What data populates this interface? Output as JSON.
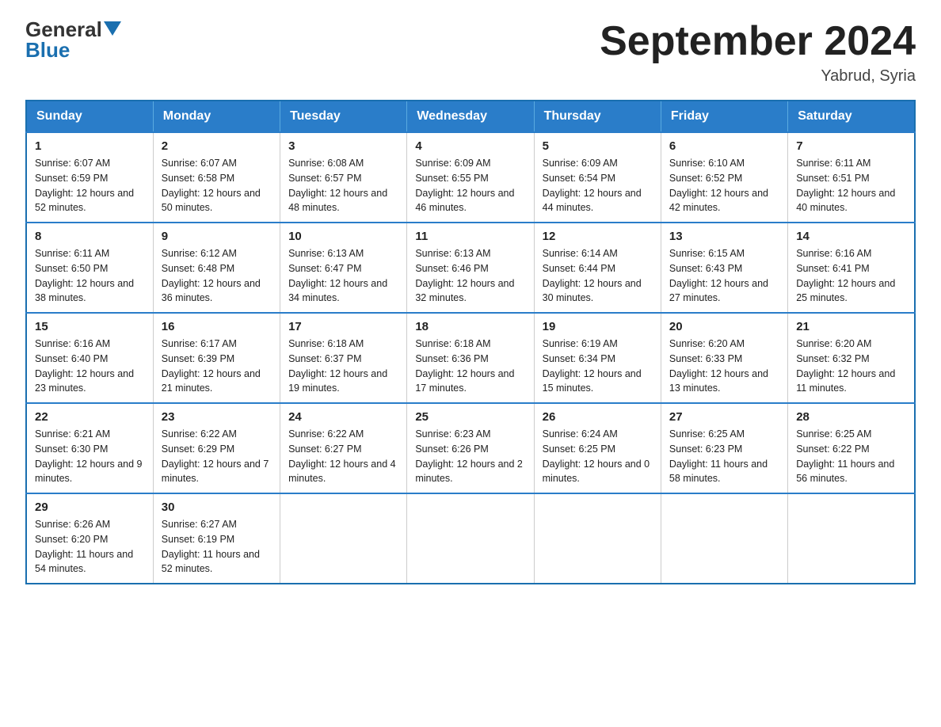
{
  "logo": {
    "general": "General",
    "blue": "Blue"
  },
  "title": "September 2024",
  "subtitle": "Yabrud, Syria",
  "days_of_week": [
    "Sunday",
    "Monday",
    "Tuesday",
    "Wednesday",
    "Thursday",
    "Friday",
    "Saturday"
  ],
  "weeks": [
    [
      {
        "day": "1",
        "sunrise": "6:07 AM",
        "sunset": "6:59 PM",
        "daylight": "12 hours and 52 minutes."
      },
      {
        "day": "2",
        "sunrise": "6:07 AM",
        "sunset": "6:58 PM",
        "daylight": "12 hours and 50 minutes."
      },
      {
        "day": "3",
        "sunrise": "6:08 AM",
        "sunset": "6:57 PM",
        "daylight": "12 hours and 48 minutes."
      },
      {
        "day": "4",
        "sunrise": "6:09 AM",
        "sunset": "6:55 PM",
        "daylight": "12 hours and 46 minutes."
      },
      {
        "day": "5",
        "sunrise": "6:09 AM",
        "sunset": "6:54 PM",
        "daylight": "12 hours and 44 minutes."
      },
      {
        "day": "6",
        "sunrise": "6:10 AM",
        "sunset": "6:52 PM",
        "daylight": "12 hours and 42 minutes."
      },
      {
        "day": "7",
        "sunrise": "6:11 AM",
        "sunset": "6:51 PM",
        "daylight": "12 hours and 40 minutes."
      }
    ],
    [
      {
        "day": "8",
        "sunrise": "6:11 AM",
        "sunset": "6:50 PM",
        "daylight": "12 hours and 38 minutes."
      },
      {
        "day": "9",
        "sunrise": "6:12 AM",
        "sunset": "6:48 PM",
        "daylight": "12 hours and 36 minutes."
      },
      {
        "day": "10",
        "sunrise": "6:13 AM",
        "sunset": "6:47 PM",
        "daylight": "12 hours and 34 minutes."
      },
      {
        "day": "11",
        "sunrise": "6:13 AM",
        "sunset": "6:46 PM",
        "daylight": "12 hours and 32 minutes."
      },
      {
        "day": "12",
        "sunrise": "6:14 AM",
        "sunset": "6:44 PM",
        "daylight": "12 hours and 30 minutes."
      },
      {
        "day": "13",
        "sunrise": "6:15 AM",
        "sunset": "6:43 PM",
        "daylight": "12 hours and 27 minutes."
      },
      {
        "day": "14",
        "sunrise": "6:16 AM",
        "sunset": "6:41 PM",
        "daylight": "12 hours and 25 minutes."
      }
    ],
    [
      {
        "day": "15",
        "sunrise": "6:16 AM",
        "sunset": "6:40 PM",
        "daylight": "12 hours and 23 minutes."
      },
      {
        "day": "16",
        "sunrise": "6:17 AM",
        "sunset": "6:39 PM",
        "daylight": "12 hours and 21 minutes."
      },
      {
        "day": "17",
        "sunrise": "6:18 AM",
        "sunset": "6:37 PM",
        "daylight": "12 hours and 19 minutes."
      },
      {
        "day": "18",
        "sunrise": "6:18 AM",
        "sunset": "6:36 PM",
        "daylight": "12 hours and 17 minutes."
      },
      {
        "day": "19",
        "sunrise": "6:19 AM",
        "sunset": "6:34 PM",
        "daylight": "12 hours and 15 minutes."
      },
      {
        "day": "20",
        "sunrise": "6:20 AM",
        "sunset": "6:33 PM",
        "daylight": "12 hours and 13 minutes."
      },
      {
        "day": "21",
        "sunrise": "6:20 AM",
        "sunset": "6:32 PM",
        "daylight": "12 hours and 11 minutes."
      }
    ],
    [
      {
        "day": "22",
        "sunrise": "6:21 AM",
        "sunset": "6:30 PM",
        "daylight": "12 hours and 9 minutes."
      },
      {
        "day": "23",
        "sunrise": "6:22 AM",
        "sunset": "6:29 PM",
        "daylight": "12 hours and 7 minutes."
      },
      {
        "day": "24",
        "sunrise": "6:22 AM",
        "sunset": "6:27 PM",
        "daylight": "12 hours and 4 minutes."
      },
      {
        "day": "25",
        "sunrise": "6:23 AM",
        "sunset": "6:26 PM",
        "daylight": "12 hours and 2 minutes."
      },
      {
        "day": "26",
        "sunrise": "6:24 AM",
        "sunset": "6:25 PM",
        "daylight": "12 hours and 0 minutes."
      },
      {
        "day": "27",
        "sunrise": "6:25 AM",
        "sunset": "6:23 PM",
        "daylight": "11 hours and 58 minutes."
      },
      {
        "day": "28",
        "sunrise": "6:25 AM",
        "sunset": "6:22 PM",
        "daylight": "11 hours and 56 minutes."
      }
    ],
    [
      {
        "day": "29",
        "sunrise": "6:26 AM",
        "sunset": "6:20 PM",
        "daylight": "11 hours and 54 minutes."
      },
      {
        "day": "30",
        "sunrise": "6:27 AM",
        "sunset": "6:19 PM",
        "daylight": "11 hours and 52 minutes."
      },
      null,
      null,
      null,
      null,
      null
    ]
  ]
}
